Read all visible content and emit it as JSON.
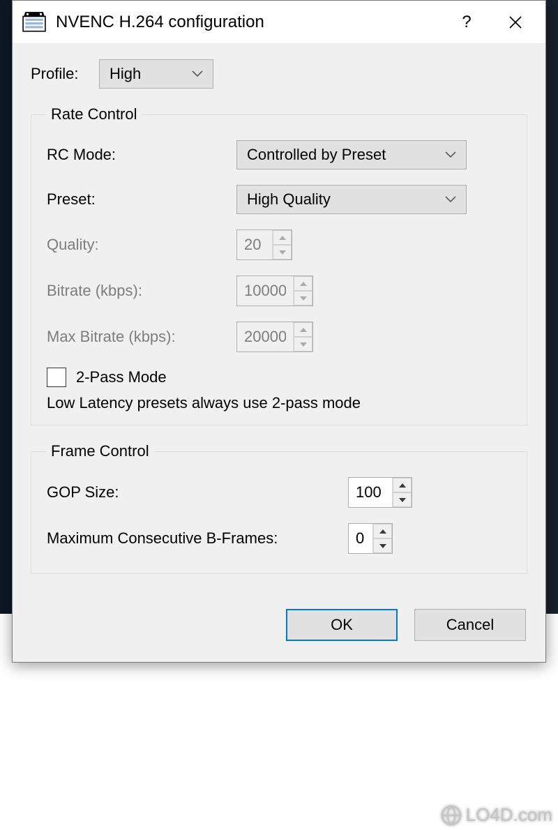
{
  "titlebar": {
    "title": "NVENC H.264 configuration",
    "help": "?",
    "close": "✕"
  },
  "profile": {
    "label": "Profile:",
    "value": "High"
  },
  "rate_control": {
    "legend": "Rate Control",
    "rc_mode": {
      "label": "RC Mode:",
      "value": "Controlled by Preset"
    },
    "preset": {
      "label": "Preset:",
      "value": "High Quality"
    },
    "quality": {
      "label": "Quality:",
      "value": "20"
    },
    "bitrate": {
      "label": "Bitrate (kbps):",
      "value": "10000"
    },
    "max_bitrate": {
      "label": "Max Bitrate (kbps):",
      "value": "20000"
    },
    "two_pass": {
      "label": "2-Pass Mode",
      "checked": false
    },
    "note": "Low Latency presets always use 2-pass mode"
  },
  "frame_control": {
    "legend": "Frame Control",
    "gop": {
      "label": "GOP Size:",
      "value": "100"
    },
    "bframes": {
      "label": "Maximum Consecutive B-Frames:",
      "value": "0"
    }
  },
  "footer": {
    "ok": "OK",
    "cancel": "Cancel"
  },
  "watermark": "LO4D.com"
}
